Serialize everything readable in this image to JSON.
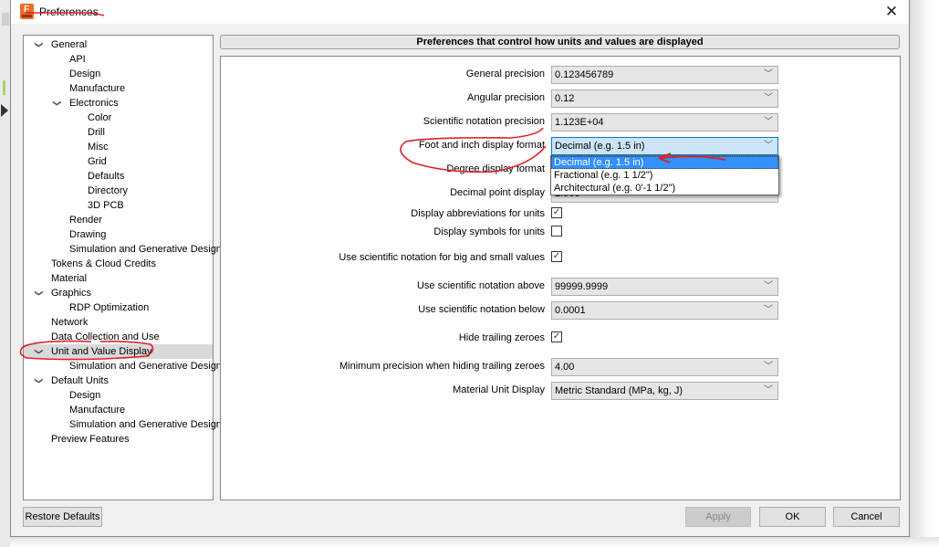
{
  "window": {
    "title": "Preferences",
    "close_icon": "close-icon",
    "app_icon": "fusion-app-icon"
  },
  "tree": {
    "items": [
      {
        "label": "General",
        "level": 0,
        "expanded": true
      },
      {
        "label": "API",
        "level": 1
      },
      {
        "label": "Design",
        "level": 1
      },
      {
        "label": "Manufacture",
        "level": 1
      },
      {
        "label": "Electronics",
        "level": 1,
        "expanded": true
      },
      {
        "label": "Color",
        "level": 2
      },
      {
        "label": "Drill",
        "level": 2
      },
      {
        "label": "Misc",
        "level": 2
      },
      {
        "label": "Grid",
        "level": 2
      },
      {
        "label": "Defaults",
        "level": 2
      },
      {
        "label": "Directory",
        "level": 2
      },
      {
        "label": "3D PCB",
        "level": 2
      },
      {
        "label": "Render",
        "level": 1
      },
      {
        "label": "Drawing",
        "level": 1
      },
      {
        "label": "Simulation and Generative Design",
        "level": 1
      },
      {
        "label": "Tokens & Cloud Credits",
        "level": 0
      },
      {
        "label": "Material",
        "level": 0
      },
      {
        "label": "Graphics",
        "level": 0,
        "expanded": true
      },
      {
        "label": "RDP Optimization",
        "level": 1
      },
      {
        "label": "Network",
        "level": 0
      },
      {
        "label": "Data Collection and Use",
        "level": 0
      },
      {
        "label": "Unit and Value Display",
        "level": 0,
        "expanded": true,
        "selected": true
      },
      {
        "label": "Simulation and Generative Design",
        "level": 1
      },
      {
        "label": "Default Units",
        "level": 0,
        "expanded": true
      },
      {
        "label": "Design",
        "level": 1
      },
      {
        "label": "Manufacture",
        "level": 1
      },
      {
        "label": "Simulation and Generative Design",
        "level": 1
      },
      {
        "label": "Preview Features",
        "level": 0
      }
    ]
  },
  "panel": {
    "header": "Preferences that control how units and values are displayed",
    "settings": {
      "general_precision": {
        "label": "General precision",
        "value": "0.123456789"
      },
      "angular_precision": {
        "label": "Angular precision",
        "value": "0.12"
      },
      "sci_precision": {
        "label": "Scientific notation precision",
        "value": "1.123E+04"
      },
      "foot_inch_format": {
        "label": "Foot and inch display format",
        "value": "Decimal (e.g. 1.5 in)"
      },
      "degree_format": {
        "label": "Degree display format"
      },
      "decimal_point": {
        "label": "Decimal point display",
        "value": "1.500"
      },
      "display_abbrev": {
        "label": "Display abbreviations for units",
        "checked": true
      },
      "display_symbols": {
        "label": "Display symbols for units",
        "checked": false
      },
      "use_sci": {
        "label": "Use scientific notation for big and small values",
        "checked": true
      },
      "sci_above": {
        "label": "Use scientific notation above",
        "value": "99999.9999"
      },
      "sci_below": {
        "label": "Use scientific notation below",
        "value": "0.0001"
      },
      "hide_trailing": {
        "label": "Hide trailing zeroes",
        "checked": true
      },
      "min_precision": {
        "label": "Minimum precision when hiding trailing zeroes",
        "value": "4.00"
      },
      "material_unit": {
        "label": "Material Unit Display",
        "value": "Metric Standard (MPa, kg, J)"
      }
    },
    "dropdown_options": [
      {
        "label": "Decimal (e.g. 1.5 in)",
        "highlighted": true
      },
      {
        "label": "Fractional (e.g. 1 1/2\")",
        "highlighted": false
      },
      {
        "label": "Architectural (e.g. 0'-1 1/2\")",
        "highlighted": false
      }
    ],
    "check_glyph": "✓",
    "chevron_glyph": "﹀"
  },
  "buttons": {
    "restore": "Restore Defaults",
    "apply": "Apply",
    "ok": "OK",
    "cancel": "Cancel"
  },
  "colors": {
    "highlight": "#3390ff",
    "annotation": "#e0202a",
    "active_combo": "#cce4f7",
    "selected_tree": "#d9d9d9"
  }
}
